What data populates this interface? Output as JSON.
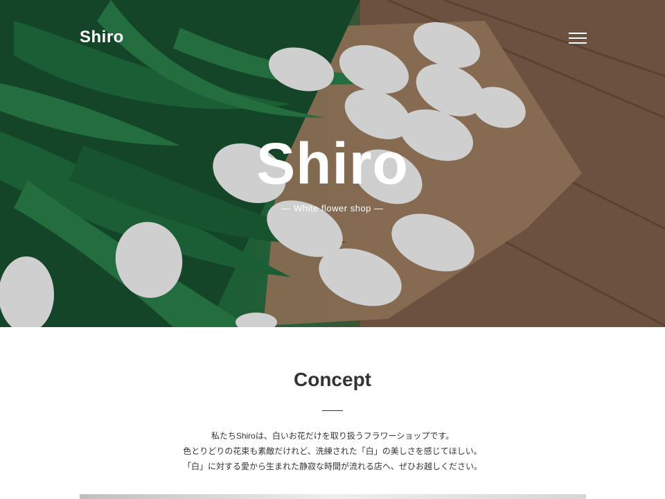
{
  "header": {
    "brand": "Shiro",
    "menu_icon": "hamburger-menu-icon"
  },
  "hero": {
    "title": "Shiro",
    "subtitle": "— White flower shop —"
  },
  "concept": {
    "title": "Concept",
    "lines": [
      "私たちShiroは、白いお花だけを取り扱うフラワーショップです。",
      "色とりどりの花束も素敵だけれど、洗練された「白」の美しさを感じてほしい。",
      "「白」に対する愛から生まれた静寂な時間が流れる店へ、ぜひお越しください。"
    ]
  },
  "colors": {
    "text": "#333333",
    "white": "#ffffff",
    "leaf_green": "#1b6b3b",
    "wood_brown": "#7a5a47"
  }
}
